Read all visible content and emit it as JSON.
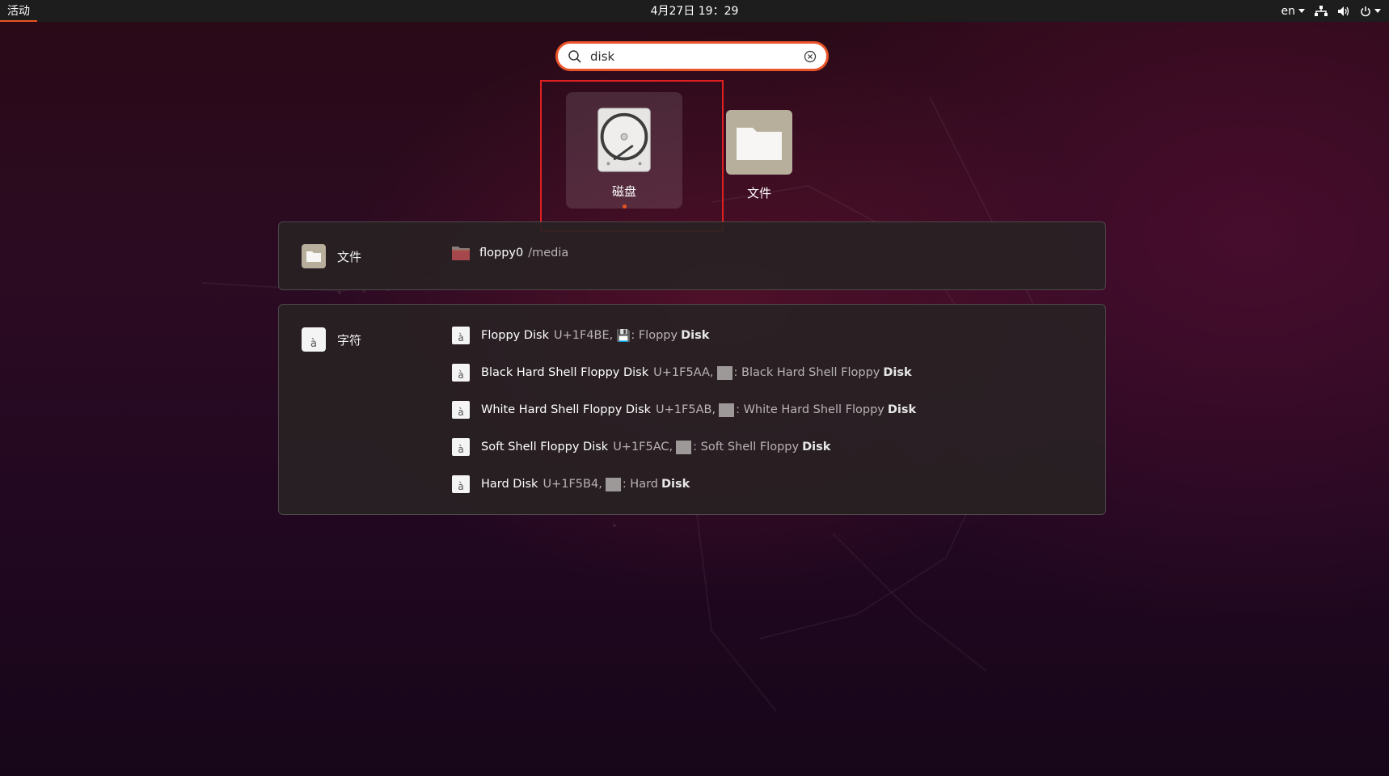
{
  "topbar": {
    "activities": "活动",
    "clock": "4月27日  19：29",
    "lang": "en"
  },
  "search": {
    "value": "disk",
    "placeholder": ""
  },
  "apps": [
    {
      "label": "磁盘",
      "running": true,
      "icon": "disk-drive-icon"
    },
    {
      "label": "文件",
      "running": false,
      "icon": "folder-icon"
    }
  ],
  "files_panel": {
    "provider": "文件",
    "results": [
      {
        "name": "floppy0",
        "path": "/media"
      }
    ]
  },
  "chars_panel": {
    "provider": "字符",
    "results": [
      {
        "name": "Floppy Disk",
        "code": "U+1F4BE,",
        "glyph": "💾",
        "desc": ": Floppy",
        "match": "Disk"
      },
      {
        "name": "Black Hard Shell Floppy Disk",
        "code": "U+1F5AA,",
        "glyph": "",
        "desc": ": Black Hard Shell Floppy",
        "match": "Disk"
      },
      {
        "name": "White Hard Shell Floppy Disk",
        "code": "U+1F5AB,",
        "glyph": "",
        "desc": ": White Hard Shell Floppy",
        "match": "Disk"
      },
      {
        "name": "Soft Shell Floppy Disk",
        "code": "U+1F5AC,",
        "glyph": "",
        "desc": ": Soft Shell Floppy",
        "match": "Disk"
      },
      {
        "name": "Hard Disk",
        "code": "U+1F5B4,",
        "glyph": "",
        "desc": ": Hard",
        "match": "Disk"
      }
    ],
    "icon_glyph": "à"
  },
  "colors": {
    "accent": "#e95420",
    "highlight": "#e02020",
    "topbar": "#1d1d1d"
  }
}
